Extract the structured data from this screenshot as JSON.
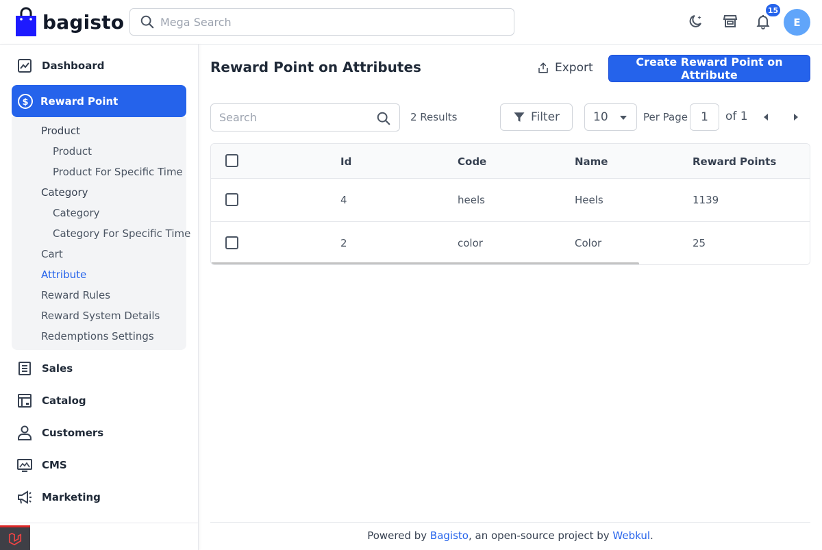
{
  "header": {
    "logo_text": "bagisto",
    "search_placeholder": "Mega Search",
    "notification_count": "15",
    "avatar_initial": "E"
  },
  "sidebar": {
    "dashboard": "Dashboard",
    "reward_point": "Reward Point",
    "submenu": {
      "product_group": "Product",
      "product": "Product",
      "product_specific_time": "Product For Specific Time",
      "category_group": "Category",
      "category": "Category",
      "category_specific_time": "Category For Specific Time",
      "cart": "Cart",
      "attribute": "Attribute",
      "reward_rules": "Reward Rules",
      "reward_system_details": "Reward System Details",
      "redemptions_settings": "Redemptions Settings"
    },
    "sales": "Sales",
    "catalog": "Catalog",
    "customers": "Customers",
    "cms": "CMS",
    "marketing": "Marketing"
  },
  "main": {
    "title": "Reward Point on Attributes",
    "export_label": "Export",
    "create_label": "Create Reward Point on Attribute",
    "search_placeholder": "Search",
    "results": "2 Results",
    "filter_label": "Filter",
    "per_page_value": "10",
    "per_page_label": "Per Page",
    "page_value": "1",
    "page_of": "of 1"
  },
  "table": {
    "columns": [
      "Id",
      "Code",
      "Name",
      "Reward Points"
    ],
    "rows": [
      {
        "id": "4",
        "code": "heels",
        "name": "Heels",
        "points": "1139"
      },
      {
        "id": "2",
        "code": "color",
        "name": "Color",
        "points": "25"
      }
    ]
  },
  "footer": {
    "prefix": "Powered by ",
    "bagisto": "Bagisto",
    "middle": ", an open-source project by ",
    "webkul": "Webkul",
    "suffix": "."
  },
  "colors": {
    "accent": "#2563eb",
    "logo_bag": "#1d1aff"
  }
}
